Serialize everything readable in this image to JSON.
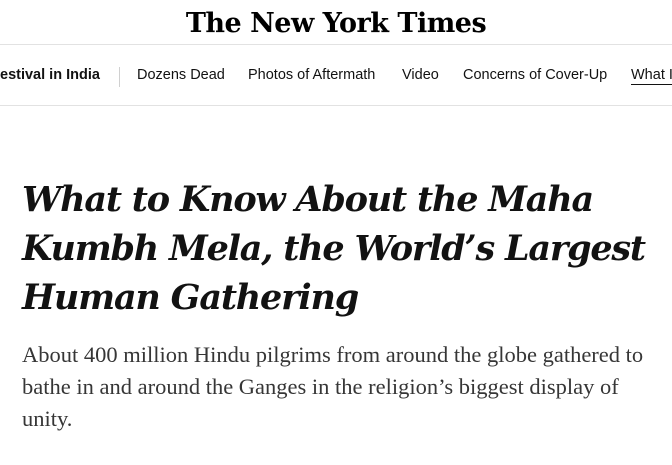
{
  "masthead": {
    "logo_text": "The New York Times"
  },
  "nav": {
    "section_title": "estival in India",
    "items": [
      {
        "label": "Dozens Dead"
      },
      {
        "label": "Photos of Aftermath"
      },
      {
        "label": "Video"
      },
      {
        "label": "Concerns of Cover-Up"
      },
      {
        "label": "What I"
      }
    ]
  },
  "article": {
    "headline": "What to Know About the Maha Kumbh Mela, the World’s Largest Human Gathering",
    "summary": "About 400 million Hindu pilgrims from around the globe gathered to bathe in and around the Ganges in the religion’s biggest display of unity."
  },
  "colors": {
    "text": "#121212",
    "summary_text": "#363636",
    "border": "#e2e2e2"
  }
}
